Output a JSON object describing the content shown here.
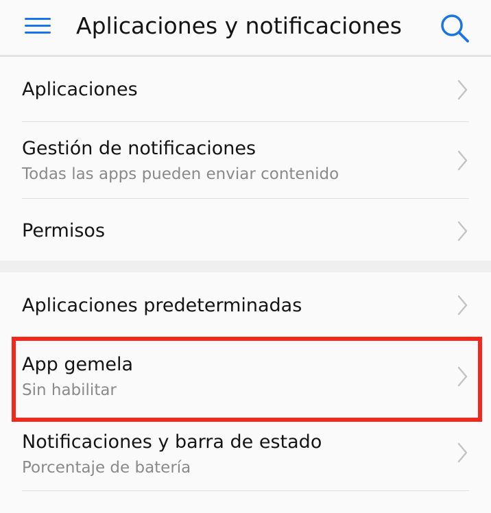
{
  "appbar": {
    "menu_icon": "hamburger-menu-icon",
    "title": "Aplicaciones y notificaciones",
    "search_icon": "search-icon",
    "accent_color": "#1a73e8"
  },
  "sections": [
    {
      "items": [
        {
          "title": "Aplicaciones",
          "subtitle": ""
        },
        {
          "title": "Gestión de notificaciones",
          "subtitle": "Todas las apps pueden enviar contenido"
        },
        {
          "title": "Permisos",
          "subtitle": ""
        }
      ]
    },
    {
      "items": [
        {
          "title": "Aplicaciones predeterminadas",
          "subtitle": ""
        },
        {
          "title": "App gemela",
          "subtitle": "Sin habilitar",
          "highlighted": true
        },
        {
          "title": "Notificaciones y barra de estado",
          "subtitle": "Porcentaje de batería"
        }
      ]
    }
  ],
  "highlight_color": "#f3281a"
}
